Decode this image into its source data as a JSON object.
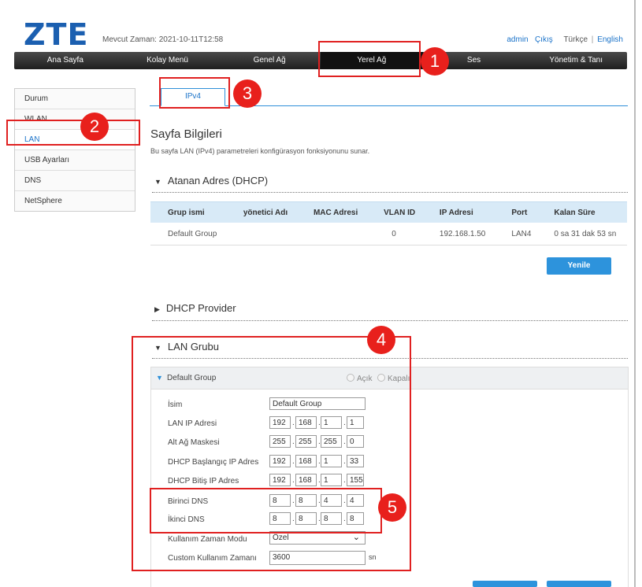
{
  "header": {
    "logo": "ZTE",
    "time": "Mevcut Zaman: 2021-10-11T12:58",
    "user": "admin",
    "logout": "Çıkış",
    "lang_tr": "Türkçe",
    "lang_sep": "|",
    "lang_en": "English"
  },
  "nav": [
    "Ana Sayfa",
    "Kolay Menü",
    "Genel Ağ",
    "Yerel Ağ",
    "Ses",
    "Yönetim & Tanı"
  ],
  "sidebar": [
    "Durum",
    "WLAN",
    "LAN",
    "USB Ayarları",
    "DNS",
    "NetSphere"
  ],
  "tab": "IPv4",
  "page": {
    "title": "Sayfa Bilgileri",
    "desc": "Bu sayfa LAN (IPv4) parametreleri konfigürasyon fonksiyonunu sunar."
  },
  "dhcp": {
    "section": "Atanan Adres (DHCP)",
    "headers": [
      "Grup ismi",
      "yönetici Adı",
      "MAC Adresi",
      "VLAN ID",
      "IP Adresi",
      "Port",
      "Kalan Süre"
    ],
    "row": [
      "Default Group",
      "",
      "",
      "0",
      "192.168.1.50",
      "LAN4",
      "0 sa 31 dak 53 sn"
    ],
    "refresh": "Yenile"
  },
  "provider": {
    "section": "DHCP Provider"
  },
  "lan_group": {
    "section": "LAN Grubu",
    "group_name": "Default Group",
    "on": "Açık",
    "off": "Kapalı",
    "fields": {
      "name_label": "İsim",
      "name_value": "Default Group",
      "ip_label": "LAN IP Adresi",
      "ip": [
        "192",
        "168",
        "1",
        "1"
      ],
      "mask_label": "Alt Ağ Maskesi",
      "mask": [
        "255",
        "255",
        "255",
        "0"
      ],
      "start_label": "DHCP Başlangıç IP Adres",
      "start": [
        "192",
        "168",
        "1",
        "33"
      ],
      "end_label": "DHCP Bitiş IP Adres",
      "end": [
        "192",
        "168",
        "1",
        "155"
      ],
      "dns1_label": "Birinci DNS",
      "dns1": [
        "8",
        "8",
        "4",
        "4"
      ],
      "dns2_label": "İkinci DNS",
      "dns2": [
        "8",
        "8",
        "8",
        "8"
      ],
      "lease_mode_label": "Kullanım Zaman Modu",
      "lease_mode": "Özel",
      "lease_time_label": "Custom Kullanım Zamanı",
      "lease_time": "3600",
      "lease_unit": "sn"
    }
  },
  "annotations": [
    "1",
    "2",
    "3",
    "4",
    "5"
  ],
  "colors": {
    "brand": "#1b5fb0",
    "accent": "#2d93dc",
    "highlight": "#e02020"
  }
}
